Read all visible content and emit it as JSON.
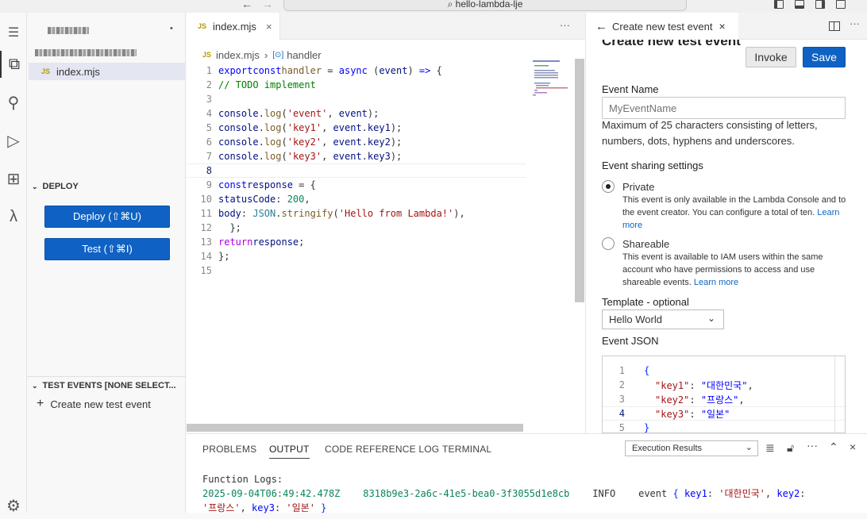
{
  "titlebar": {
    "back": "←",
    "forward": "→",
    "search_icon": "⌕",
    "search_text": "hello-lambda-lje"
  },
  "activity": {
    "menu": "☰",
    "explorer": "⧉",
    "search": "⚲",
    "debug": "▷",
    "extensions": "⊞",
    "lambda": "λ",
    "settings": "⚙"
  },
  "sidebar": {
    "file": "index.mjs",
    "deploy_section": "DEPLOY",
    "deploy_button": "Deploy (⇧⌘U)",
    "test_button": "Test (⇧⌘I)",
    "test_events_section": "TEST EVENTS [NONE SELECT...",
    "create_event": "Create new test event",
    "section_chevron": "⌄",
    "more": "•"
  },
  "editor": {
    "tab_label": "index.mjs",
    "tab_close": "×",
    "more": "···",
    "breadcrumb_file": "index.mjs",
    "breadcrumb_sep": "›",
    "breadcrumb_symbol_icon": "[⊙]",
    "breadcrumb_symbol": "handler",
    "line_numbers": [
      "1",
      "2",
      "3",
      "4",
      "5",
      "6",
      "7",
      "8",
      "9",
      "10",
      "11",
      "12",
      "13",
      "14",
      "15"
    ]
  },
  "panel": {
    "tab_label": "Create new test event",
    "tab_close": "×",
    "title": "Create new test event",
    "invoke_label": "Invoke",
    "save_label": "Save",
    "event_name_label": "Event Name",
    "event_name_placeholder": "MyEventName",
    "event_name_hint": "Maximum of 25 characters consisting of letters, numbers, dots, hyphens and underscores.",
    "sharing_label": "Event sharing settings",
    "private_label": "Private",
    "private_desc": "This event is only available in the Lambda Console and to the event creator. You can configure a total of ten.",
    "shareable_label": "Shareable",
    "shareable_desc": "This event is available to IAM users within the same account who have permissions to access and use shareable events.",
    "learn_more": "Learn more",
    "template_label": "Template - optional",
    "template_value": "Hello World",
    "event_json_label": "Event JSON",
    "json_line_numbers": [
      "1",
      "2",
      "3",
      "4",
      "5"
    ]
  },
  "bottom": {
    "tabs": [
      "PROBLEMS",
      "OUTPUT",
      "CODE REFERENCE LOG",
      "TERMINAL"
    ],
    "active_tab": "OUTPUT",
    "select_value": "Execution Results",
    "log_header": "Function Logs:",
    "log_timestamp": "2025-09-04T06:49:42.478Z",
    "log_request_id": "8318b9e3-2a6c-41e5-bea0-3f3055d1e8cb",
    "log_level": "INFO",
    "log_msg_prefix": "event",
    "log_key1": "key1",
    "log_val1": "'대한민국'",
    "log_key2": "key2",
    "log_val2": "'프랑스'",
    "log_key3": "key3",
    "log_val3": "'일본'"
  },
  "colors": {
    "primary_button": "#0f62c4",
    "link": "#0b66c3"
  }
}
